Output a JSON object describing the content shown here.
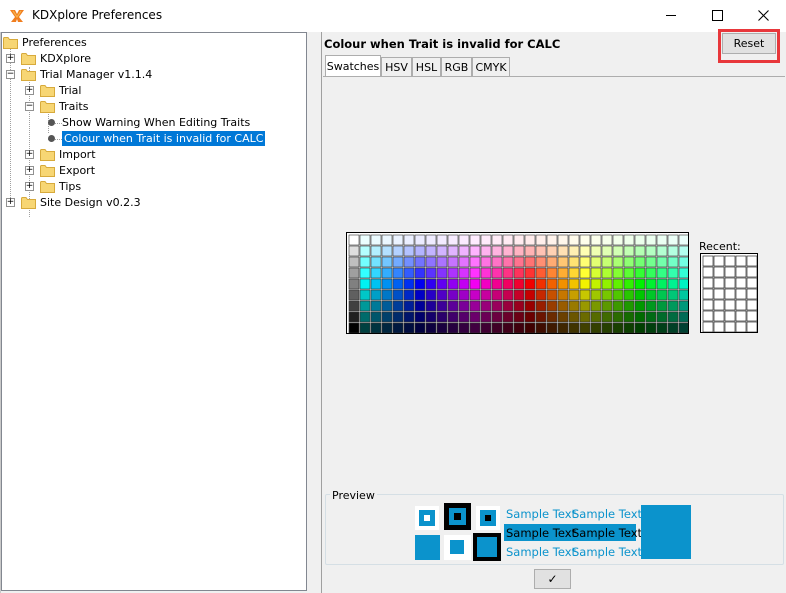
{
  "window": {
    "title": "KDXplore Preferences",
    "icon": "kdx-app-icon"
  },
  "tree": {
    "items": [
      {
        "label": "Preferences",
        "type": "root-folder"
      },
      {
        "label": "KDXplore",
        "type": "folder",
        "expander": "+"
      },
      {
        "label": "Trial Manager v1.1.4",
        "type": "folder",
        "expander": "-"
      },
      {
        "label": "Trial",
        "type": "folder",
        "expander": "+"
      },
      {
        "label": "Traits",
        "type": "folder",
        "expander": "-"
      },
      {
        "label": "Show Warning When Editing Traits",
        "type": "leaf"
      },
      {
        "label": "Colour when Trait is invalid for CALC",
        "type": "leaf",
        "selected": true
      },
      {
        "label": "Import",
        "type": "folder",
        "expander": "+"
      },
      {
        "label": "Export",
        "type": "folder",
        "expander": "+"
      },
      {
        "label": "Tips",
        "type": "folder",
        "expander": "+"
      },
      {
        "label": "Site Design v0.2.3",
        "type": "folder",
        "expander": "+"
      }
    ]
  },
  "panel": {
    "title": "Colour when Trait is invalid for CALC",
    "reset_label": "Reset",
    "tabs": [
      "Swatches",
      "HSV",
      "HSL",
      "RGB",
      "CMYK"
    ],
    "active_tab": "Swatches",
    "recent_label": "Recent:",
    "preview_label": "Preview",
    "sample_text": "Sample Text",
    "ok_label": "✓",
    "selected_color": "#0b93cc"
  }
}
